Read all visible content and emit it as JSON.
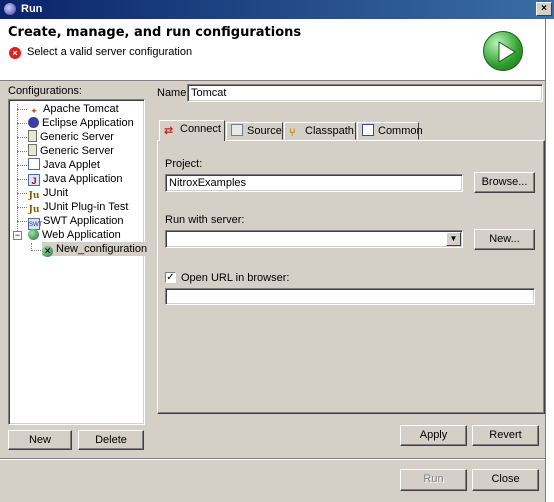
{
  "window": {
    "title": "Run",
    "close_glyph": "×"
  },
  "header": {
    "title": "Create, manage, and run configurations",
    "message": "Select a valid server configuration",
    "error_glyph": "×"
  },
  "configurations": {
    "label": "Configurations:",
    "items": [
      {
        "label": "Apache Tomcat",
        "icon": "tomcat-icon"
      },
      {
        "label": "Eclipse Application",
        "icon": "eclipse-icon"
      },
      {
        "label": "Generic Server",
        "icon": "server-icon"
      },
      {
        "label": "Generic Server",
        "icon": "server-icon"
      },
      {
        "label": "Java Applet",
        "icon": "applet-icon"
      },
      {
        "label": "Java Application",
        "icon": "java-app-icon"
      },
      {
        "label": "JUnit",
        "icon": "junit-icon"
      },
      {
        "label": "JUnit Plug-in Test",
        "icon": "junit-plugin-icon"
      },
      {
        "label": "SWT Application",
        "icon": "swt-icon"
      },
      {
        "label": "Web Application",
        "icon": "web-app-icon"
      },
      {
        "label": "New_configuration",
        "icon": "web-config-error-icon"
      }
    ],
    "expander_glyph": "−"
  },
  "name": {
    "label": "Name:",
    "value": "Tomcat"
  },
  "tabs": [
    {
      "label": "Connect",
      "icon": "connect-icon"
    },
    {
      "label": "Source",
      "icon": "source-icon"
    },
    {
      "label": "Classpath",
      "icon": "classpath-icon"
    },
    {
      "label": "Common",
      "icon": "common-icon"
    }
  ],
  "connect": {
    "project_label": "Project:",
    "project_value": "NitroxExamples",
    "browse_button": "Browse...",
    "server_label": "Run with server:",
    "server_value": "",
    "new_button": "New...",
    "open_url_label": "Open URL in browser:",
    "open_url_checked": true,
    "check_glyph": "✓",
    "url_value": ""
  },
  "buttons": {
    "new": "New",
    "delete": "Delete",
    "apply": "Apply",
    "revert": "Revert",
    "run": "Run",
    "close": "Close"
  },
  "colors": {
    "title_bar": "#0a246a",
    "dialog_bg": "#d4d0c8",
    "error": "#e02020",
    "run_green": "#2e9e2e"
  }
}
